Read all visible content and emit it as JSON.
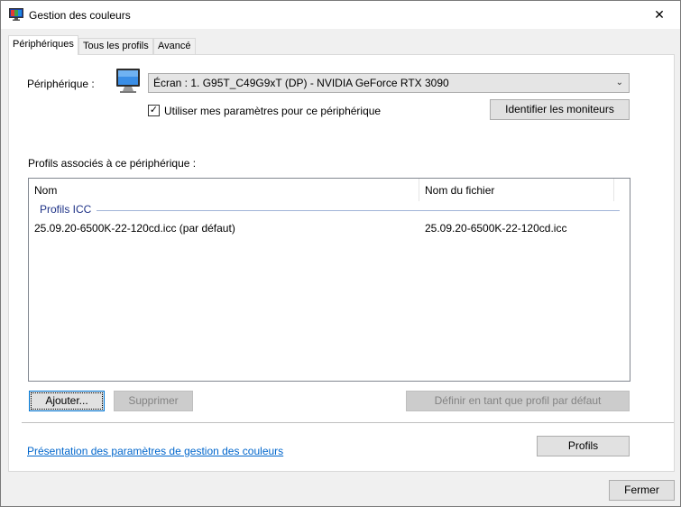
{
  "window": {
    "title": "Gestion des couleurs",
    "close_glyph": "✕"
  },
  "tabs": [
    {
      "label": "Périphériques"
    },
    {
      "label": "Tous les profils"
    },
    {
      "label": "Avancé"
    }
  ],
  "device": {
    "label": "Périphérique :",
    "selected": "Écran : 1. G95T_C49G9xT (DP) - NVIDIA GeForce RTX 3090",
    "use_settings_label": "Utiliser mes paramètres pour ce périphérique",
    "use_settings_checked": true,
    "check_glyph": "✓",
    "identify_button": "Identifier les moniteurs"
  },
  "profiles": {
    "section_label": "Profils associés à ce périphérique :",
    "columns": [
      "Nom",
      "Nom du fichier"
    ],
    "group_label": "Profils ICC",
    "rows": [
      {
        "name": "25.09.20-6500K-22-120cd.icc (par défaut)",
        "file": "25.09.20-6500K-22-120cd.icc"
      }
    ]
  },
  "buttons": {
    "add": "Ajouter...",
    "remove": "Supprimer",
    "set_default": "Définir en tant que profil par défaut",
    "profiles": "Profils",
    "close": "Fermer"
  },
  "link": {
    "text": "Présentation des paramètres de gestion des couleurs"
  },
  "colors": {
    "link": "#0066cc",
    "group_text": "#1e3287",
    "focus_border": "#0078d7"
  }
}
